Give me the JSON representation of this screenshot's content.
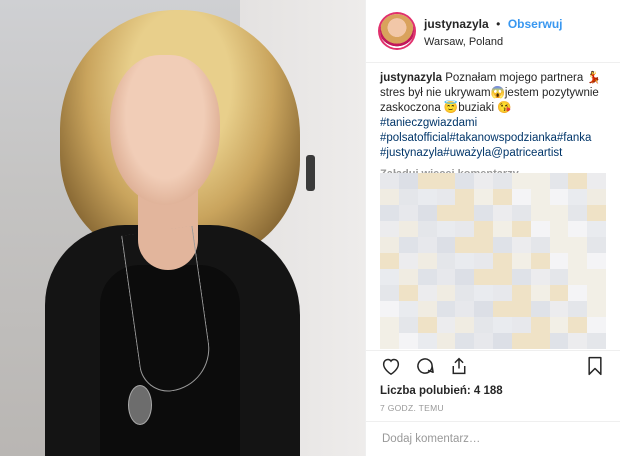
{
  "post": {
    "username": "justynazyla",
    "dot": "•",
    "follow_label": "Obserwuj",
    "location": "Warsaw, Poland",
    "caption_user": "justynazyla",
    "caption_text": "Poznałam mojego partnera 💃 stres był nie ukrywam😱jestem pozytywnie zaskoczona 😇buziaki 😘",
    "hashtags": [
      "#tanieczgwiazdami",
      "#polsatofficial",
      "#takanowspodzianka",
      "#fanka",
      "#justynazyla",
      "#uważyla",
      "@patriceartist"
    ],
    "load_more": "Załaduj więcej komentarzy",
    "likes_text": "Liczba polubień: 4 188",
    "time_text": "7 GODZ. TEMU",
    "add_comment_placeholder": "Dodaj komentarz…"
  },
  "icons": {
    "like": "heart-icon",
    "comment": "comment-icon",
    "share": "share-icon",
    "save": "bookmark-icon"
  },
  "colors": {
    "link": "#3897f0",
    "hashtag": "#003569",
    "muted": "#999999"
  }
}
